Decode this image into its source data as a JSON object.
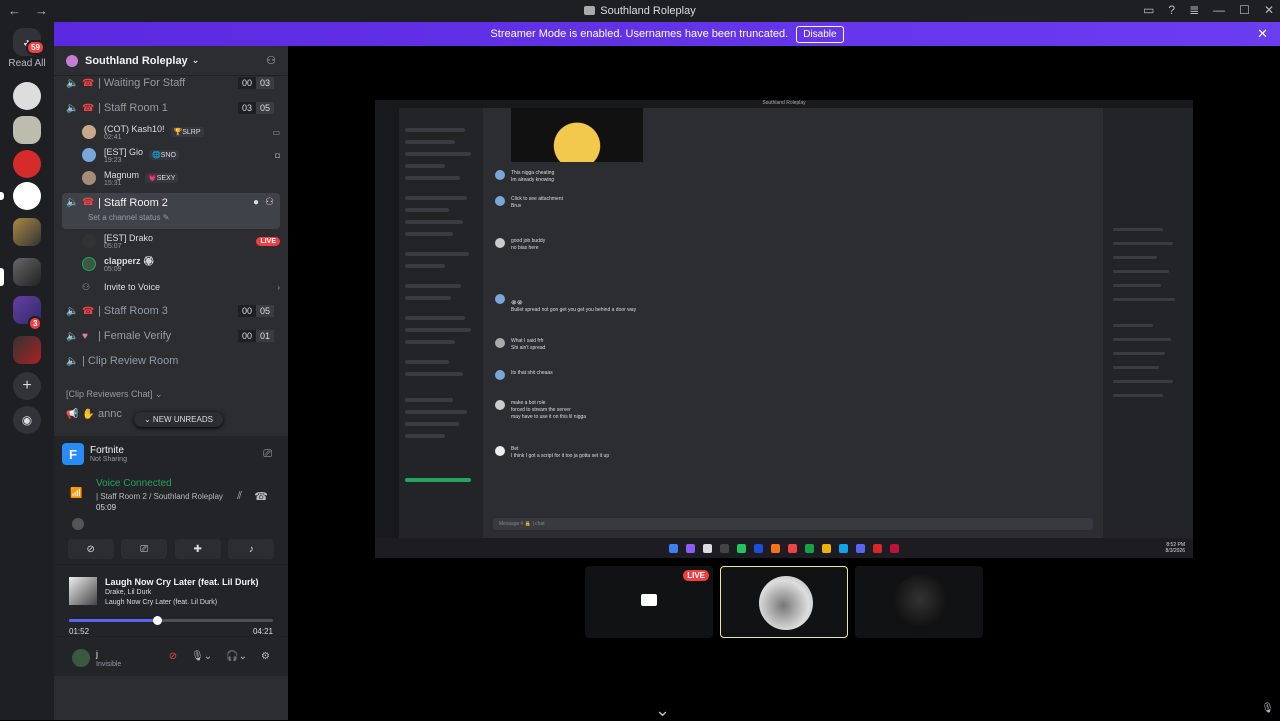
{
  "window": {
    "title": "Southland Roleplay"
  },
  "banner": {
    "text": "Streamer Mode is enabled. Usernames have been truncated.",
    "button": "Disable"
  },
  "rail": {
    "badge": "59",
    "read_all": "Read All",
    "badge2": "3"
  },
  "server": {
    "name": "Southland Roleplay"
  },
  "channels": {
    "waiting": {
      "label": "| Waiting For Staff",
      "c1": "00",
      "c2": "03"
    },
    "staff1": {
      "label": "| Staff Room 1",
      "c1": "03",
      "c2": "05"
    },
    "staff1_users": [
      {
        "name": "(COT) Kash10!",
        "sub": "02:41",
        "tag": "🏆SLRP"
      },
      {
        "name": "[EST] Gio",
        "sub": "19:23",
        "tag": "🌐SNO"
      },
      {
        "name": "Magnum",
        "sub": "15:31",
        "tag": "💗SEXY"
      }
    ],
    "staff2": {
      "label": "| Staff Room 2",
      "status": "Set a channel status ✎"
    },
    "staff2_users": [
      {
        "name": "[EST] Drako",
        "sub": "05:07",
        "live": "LIVE"
      },
      {
        "name": "clapperz 🏵",
        "sub": "05:09"
      }
    ],
    "invite": "Invite to Voice",
    "staff3": {
      "label": "| Staff Room 3",
      "c1": "00",
      "c2": "05"
    },
    "female": {
      "label": "| Female Verify",
      "c1": "00",
      "c2": "01"
    },
    "clip": {
      "label": "| Clip Review Room"
    },
    "category": "[Clip Reviewers Chat] ⌄",
    "annc": "annc",
    "new_unreads": "⌄ NEW UNREADS"
  },
  "activity": {
    "game": "Fortnite",
    "status": "Not Sharing"
  },
  "voice": {
    "title": "Voice Connected",
    "channel": "| Staff Room 2 / Southland Roleplay",
    "time": "05:09"
  },
  "music": {
    "title": "Laugh Now Cry Later (feat. Lil Durk)",
    "artist": "Drake, Lil Durk",
    "album": "Laugh Now Cry Later (feat. Lil Durk)",
    "elapsed": "01:52",
    "total": "04:21",
    "progress": 0.43
  },
  "user": {
    "name": "j",
    "status": "Invisible"
  },
  "stream": {
    "title": "Southland Roleplay",
    "messages": [
      "This nigga cheating",
      "Im already knowing",
      "Click to see attachment",
      "Bruv",
      "good job buddy",
      "no bias here",
      "Bullet spread not gon get you get you behind a door way",
      "What I said frfr",
      "Shi ain't spread",
      "Its that shit cheaas",
      "make a bot role",
      "forced to stream the server",
      "may have to use it on this lil nigga",
      "Bet",
      "I think I got a script for it too ja gotta set it up"
    ],
    "input_placeholder": "Message # 🔒 | chat",
    "clock_time": "8:52 PM",
    "clock_date": "8/3/2026"
  },
  "tiles": {
    "live": "LIVE"
  }
}
